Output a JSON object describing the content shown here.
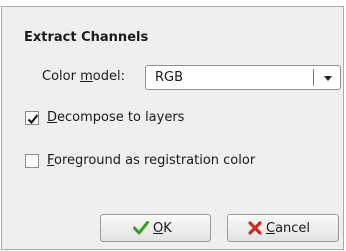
{
  "dialog": {
    "title": "Extract Channels",
    "color_model": {
      "label_prefix": "Color ",
      "label_mnemonic": "m",
      "label_suffix": "odel:",
      "value": "RGB"
    },
    "decompose": {
      "checked": true,
      "mnemonic": "D",
      "label_rest": "ecompose to layers"
    },
    "foreground": {
      "checked": false,
      "mnemonic": "F",
      "label_rest": "oreground as registration color"
    },
    "buttons": {
      "ok": {
        "mnemonic": "O",
        "rest": "K",
        "icon": "checkmark-icon",
        "icon_color": "#3aa21a"
      },
      "cancel": {
        "mnemonic": "C",
        "rest": "ancel",
        "icon": "red-x-icon",
        "icon_color": "#d8261c"
      }
    }
  }
}
